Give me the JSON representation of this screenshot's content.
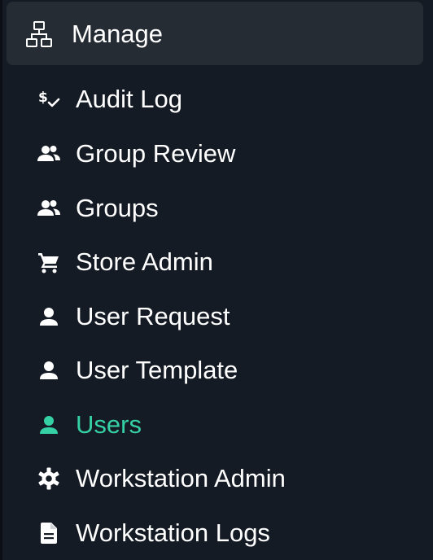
{
  "section": {
    "label": "Manage",
    "icon": "sitemap-icon"
  },
  "menu": {
    "items": [
      {
        "label": "Audit Log",
        "icon": "dollar-check-icon",
        "active": false
      },
      {
        "label": "Group Review",
        "icon": "people-icon",
        "active": false
      },
      {
        "label": "Groups",
        "icon": "people-icon",
        "active": false
      },
      {
        "label": "Store Admin",
        "icon": "cart-icon",
        "active": false
      },
      {
        "label": "User Request",
        "icon": "person-icon",
        "active": false
      },
      {
        "label": "User Template",
        "icon": "person-icon",
        "active": false
      },
      {
        "label": "Users",
        "icon": "person-icon",
        "active": true
      },
      {
        "label": "Workstation Admin",
        "icon": "gear-icon",
        "active": false
      },
      {
        "label": "Workstation Logs",
        "icon": "document-icon",
        "active": false
      }
    ]
  },
  "colors": {
    "background": "#151b24",
    "header_background": "#262c34",
    "text": "#ffffff",
    "accent": "#35d0a4"
  }
}
